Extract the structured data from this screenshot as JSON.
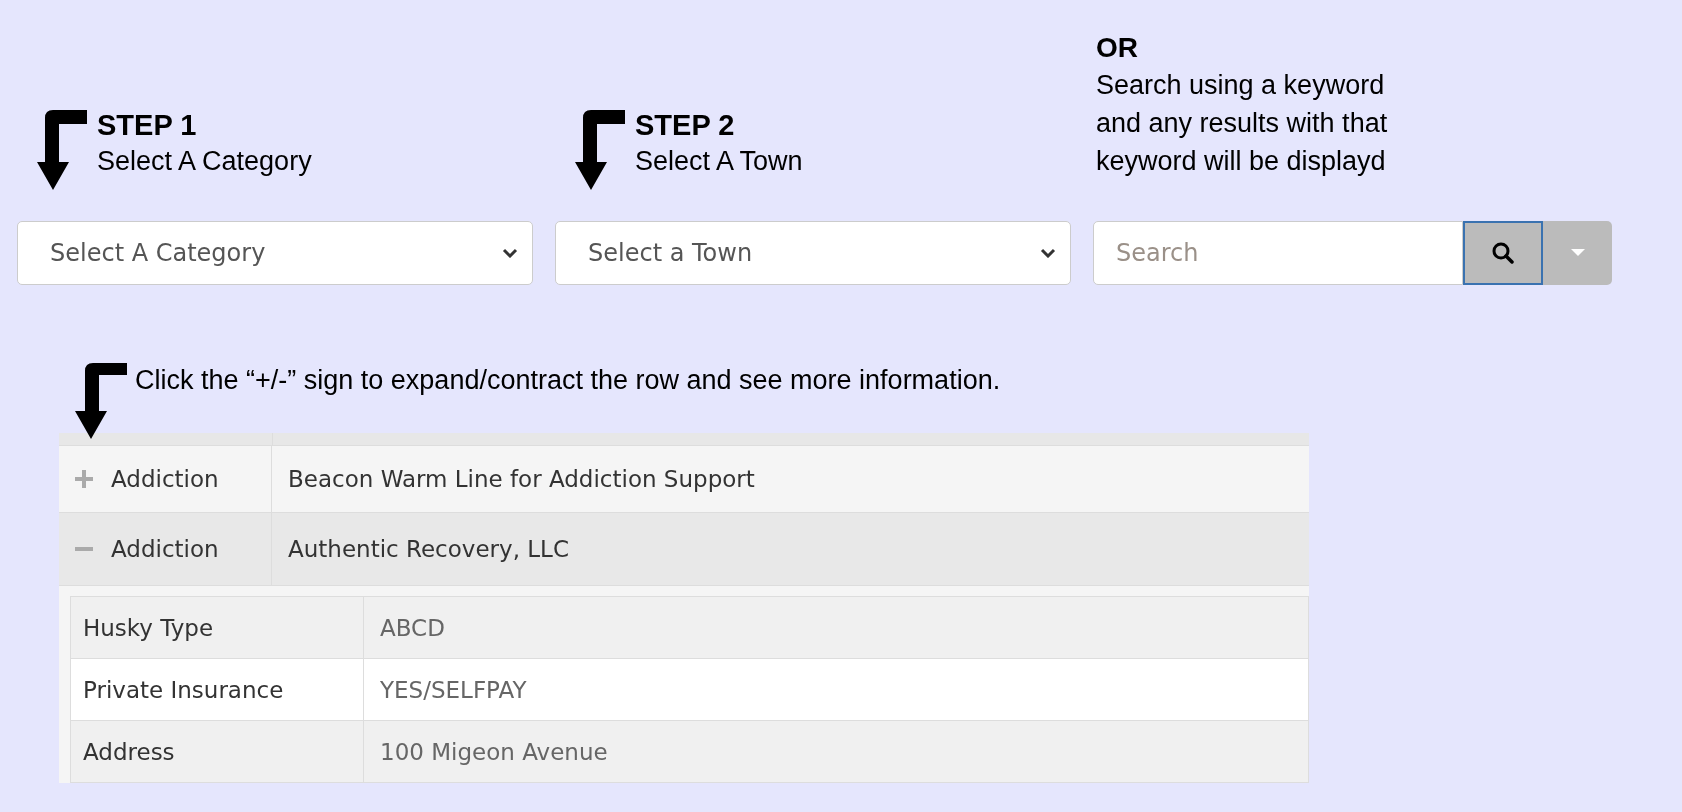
{
  "steps": [
    {
      "title": "STEP 1",
      "text": "Select A Category",
      "select": {
        "placeholder": "Select A Category"
      }
    },
    {
      "title": "STEP 2",
      "text": "Select A Town",
      "select": {
        "placeholder": "Select a Town"
      }
    }
  ],
  "search_block": {
    "title": "OR",
    "lines": [
      "Search using a keyword",
      "and any results with that",
      "keyword will be displayd"
    ],
    "placeholder": "Search"
  },
  "instruction": "Click the “+/-” sign to expand/contract the row and see more information.",
  "rows": [
    {
      "expanded": false,
      "category": "Addiction",
      "name": "Beacon Warm Line for Addiction Support"
    },
    {
      "expanded": true,
      "category": "Addiction",
      "name": "Authentic Recovery, LLC",
      "details": [
        {
          "label": "Husky Type",
          "value": "ABCD"
        },
        {
          "label": "Private Insurance",
          "value": "YES/SELFPAY"
        },
        {
          "label": "Address",
          "value": "100 Migeon Avenue"
        }
      ]
    }
  ]
}
